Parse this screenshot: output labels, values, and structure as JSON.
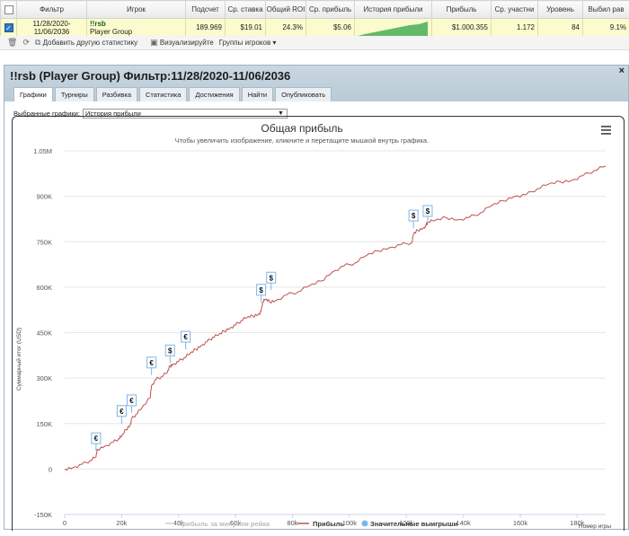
{
  "grid": {
    "headers": [
      "Фильтр",
      "Игрок",
      "Подсчет",
      "Ср. ставка",
      "Общий ROI",
      "Ср. прибыль",
      "История прибыли",
      "Прибыль",
      "Ср. участни",
      "Уровень",
      "Выбил рав"
    ],
    "row": {
      "filter_line1": "11/28/2020-",
      "filter_line2": "11/06/2036",
      "player_name": "!!rsb",
      "player_group": "Player Group",
      "count": "189.969",
      "avg_stake": "$19.01",
      "roi": "24.3%",
      "avg_profit": "$5.06",
      "profit": "$1.000.355",
      "avg_entrants": "1.172",
      "level": "84",
      "knockout": "9.1%"
    }
  },
  "toolbar": {
    "add_stat": "Добавить другую статистику",
    "visualize": "Визуализируйте",
    "groups": "Группы игроков"
  },
  "panel": {
    "title": "!!rsb (Player Group) Фильтр:11/28/2020-11/06/2036",
    "close": "×",
    "tabs": [
      "Графики",
      "Турниры",
      "Разбивка",
      "Статистика",
      "Достижения",
      "Найти",
      "Опубликовать"
    ],
    "selector_label": "Выбранные графики:",
    "selector_value": "История прибыли"
  },
  "chart_data": {
    "type": "line",
    "title": "Общая прибыль",
    "subtitle": "Чтобы увеличить изображение, кликните и перетащите мышкой внутрь графика.",
    "xlabel": "Номер игры",
    "ylabel": "Суммарный итог (USD)",
    "xlim": [
      0,
      190000
    ],
    "ylim": [
      -150000,
      1050000
    ],
    "x_ticks": [
      "0",
      "20k",
      "40k",
      "60k",
      "80k",
      "100k",
      "120k",
      "140k",
      "160k",
      "180k"
    ],
    "y_ticks": [
      "-150K",
      "0",
      "150K",
      "300K",
      "450K",
      "600K",
      "750K",
      "900K",
      "1.05M"
    ],
    "legend": [
      "Прибыль за минусом рейка",
      "Прибыль",
      "Значительные выигрыши"
    ],
    "series": [
      {
        "name": "Прибыль",
        "color": "#c0504d",
        "x": [
          0,
          3000,
          6000,
          9000,
          11000,
          11500,
          14000,
          17000,
          19000,
          20000,
          21500,
          23000,
          23500,
          25000,
          27000,
          30000,
          30500,
          32000,
          34000,
          36000,
          37000,
          38000,
          40000,
          42000,
          44000,
          46000,
          48000,
          50000,
          52000,
          54000,
          56000,
          58000,
          60000,
          62000,
          64000,
          66000,
          68000,
          69000,
          69500,
          70500,
          72000,
          74000,
          78000,
          82000,
          86000,
          90000,
          94000,
          98000,
          102000,
          106000,
          110000,
          114000,
          118000,
          122000,
          122500,
          124000,
          126000,
          127000,
          127500,
          130000,
          134000,
          138000,
          142000,
          146000,
          150000,
          154000,
          158000,
          162000,
          166000,
          170000,
          174000,
          178000,
          182000,
          186000,
          190000
        ],
        "y": [
          0,
          5000,
          15000,
          28000,
          40000,
          65000,
          75000,
          88000,
          100000,
          108000,
          130000,
          145000,
          165000,
          180000,
          200000,
          235000,
          275000,
          295000,
          305000,
          318000,
          340000,
          345000,
          355000,
          368000,
          380000,
          395000,
          408000,
          420000,
          435000,
          442000,
          455000,
          465000,
          475000,
          490000,
          500000,
          505000,
          510000,
          520000,
          550000,
          560000,
          552000,
          555000,
          575000,
          585000,
          605000,
          620000,
          650000,
          670000,
          680000,
          705000,
          720000,
          730000,
          740000,
          748000,
          775000,
          788000,
          795000,
          805000,
          815000,
          820000,
          830000,
          822000,
          830000,
          845000,
          870000,
          885000,
          900000,
          905000,
          925000,
          940000,
          948000,
          952000,
          968000,
          985000,
          1000000
        ]
      }
    ],
    "markers": [
      {
        "x": 11000,
        "y": 60000,
        "label": "€"
      },
      {
        "x": 20000,
        "y": 150000,
        "label": "€"
      },
      {
        "x": 23500,
        "y": 185000,
        "label": "€"
      },
      {
        "x": 30500,
        "y": 310000,
        "label": "€"
      },
      {
        "x": 37000,
        "y": 350000,
        "label": "$"
      },
      {
        "x": 42500,
        "y": 395000,
        "label": "€"
      },
      {
        "x": 69000,
        "y": 550000,
        "label": "$"
      },
      {
        "x": 72500,
        "y": 590000,
        "label": "$"
      },
      {
        "x": 122500,
        "y": 795000,
        "label": "$"
      },
      {
        "x": 127500,
        "y": 810000,
        "label": "$"
      }
    ]
  }
}
